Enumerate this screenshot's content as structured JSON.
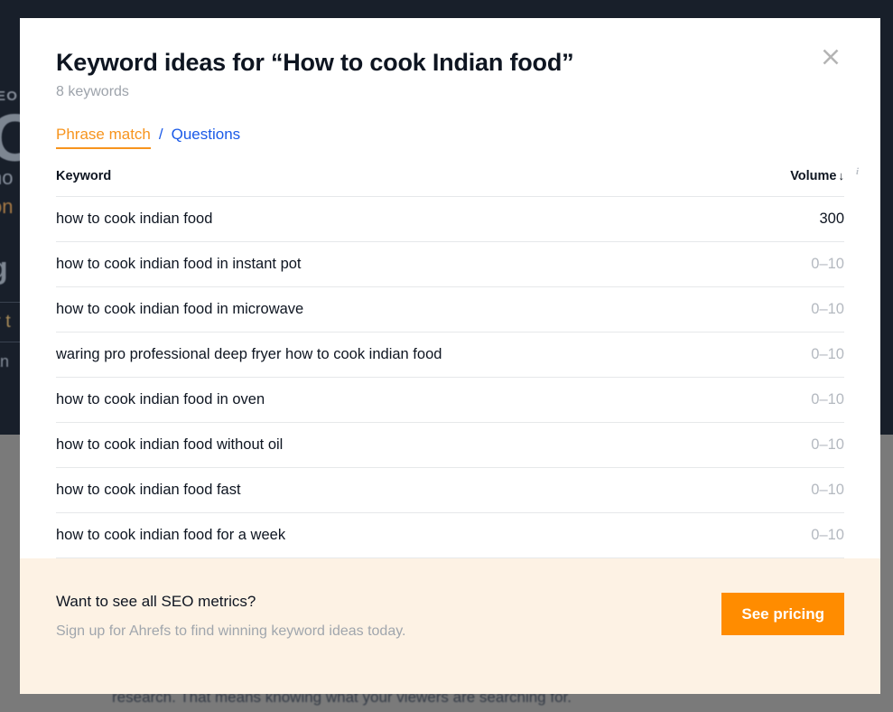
{
  "backdrop": {
    "eyebrow": "EO",
    "bigword": "O",
    "line1": "no",
    "line2": "on",
    "line3": "g",
    "line4": "r t",
    "line5": "an",
    "bottom_text": "research. That means knowing what your viewers are searching for."
  },
  "modal": {
    "title": "Keyword ideas for “How to cook Indian food”",
    "keyword_count": "8 keywords",
    "close_icon": "close-icon",
    "tabs": [
      {
        "label": "Phrase match",
        "active": true
      },
      {
        "label": "Questions",
        "active": false
      }
    ],
    "tab_separator": "/",
    "table": {
      "columns": {
        "keyword": "Keyword",
        "volume": "Volume",
        "sort_arrow": "↓",
        "info_icon": "i"
      },
      "rows": [
        {
          "keyword": "how to cook indian food",
          "volume": "300",
          "muted": false
        },
        {
          "keyword": "how to cook indian food in instant pot",
          "volume": "0–10",
          "muted": true
        },
        {
          "keyword": "how to cook indian food in microwave",
          "volume": "0–10",
          "muted": true
        },
        {
          "keyword": "waring pro professional deep fryer how to cook indian food",
          "volume": "0–10",
          "muted": true
        },
        {
          "keyword": "how to cook indian food in oven",
          "volume": "0–10",
          "muted": true
        },
        {
          "keyword": "how to cook indian food without oil",
          "volume": "0–10",
          "muted": true
        },
        {
          "keyword": "how to cook indian food fast",
          "volume": "0–10",
          "muted": true
        },
        {
          "keyword": "how to cook indian food for a week",
          "volume": "0–10",
          "muted": true
        }
      ]
    },
    "cta": {
      "title": "Want to see all SEO metrics?",
      "subtitle": "Sign up for Ahrefs to find winning keyword ideas today.",
      "button_label": "See pricing"
    }
  },
  "colors": {
    "accent_orange": "#f7941d",
    "button_orange": "#ff8c00",
    "link_blue": "#1a5ae8",
    "cta_background": "#fdf2e4",
    "backdrop_dark": "#181f2a",
    "backdrop_gray": "#7a7a7a"
  }
}
